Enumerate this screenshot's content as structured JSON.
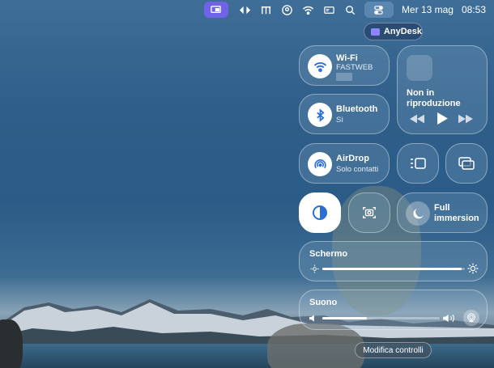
{
  "menubar": {
    "date": "Mer 13 mag",
    "time": "08:53",
    "icons": [
      "screen-share-icon",
      "arrows-icon",
      "grid-icon",
      "user-circle-icon",
      "wifi-icon",
      "card-icon",
      "search-icon",
      "control-center-icon"
    ]
  },
  "anydesk": {
    "label": "AnyDesk"
  },
  "tiles": {
    "wifi": {
      "title": "Wi-Fi",
      "network": "FASTWEB"
    },
    "bluetooth": {
      "title": "Bluetooth",
      "status": "Sì"
    },
    "airdrop": {
      "title": "AirDrop",
      "status": "Solo contatti"
    },
    "now_playing": {
      "title": "Non in riproduzione"
    },
    "focus": {
      "title": "Full immersion"
    },
    "display": {
      "title": "Schermo",
      "level": 0.98
    },
    "sound": {
      "title": "Suono",
      "level": 0.38
    }
  },
  "footer": {
    "edit_label": "Modifica controlli"
  },
  "colors": {
    "accent": "#2b6fd6",
    "menubar_active": "#6f63e6"
  }
}
